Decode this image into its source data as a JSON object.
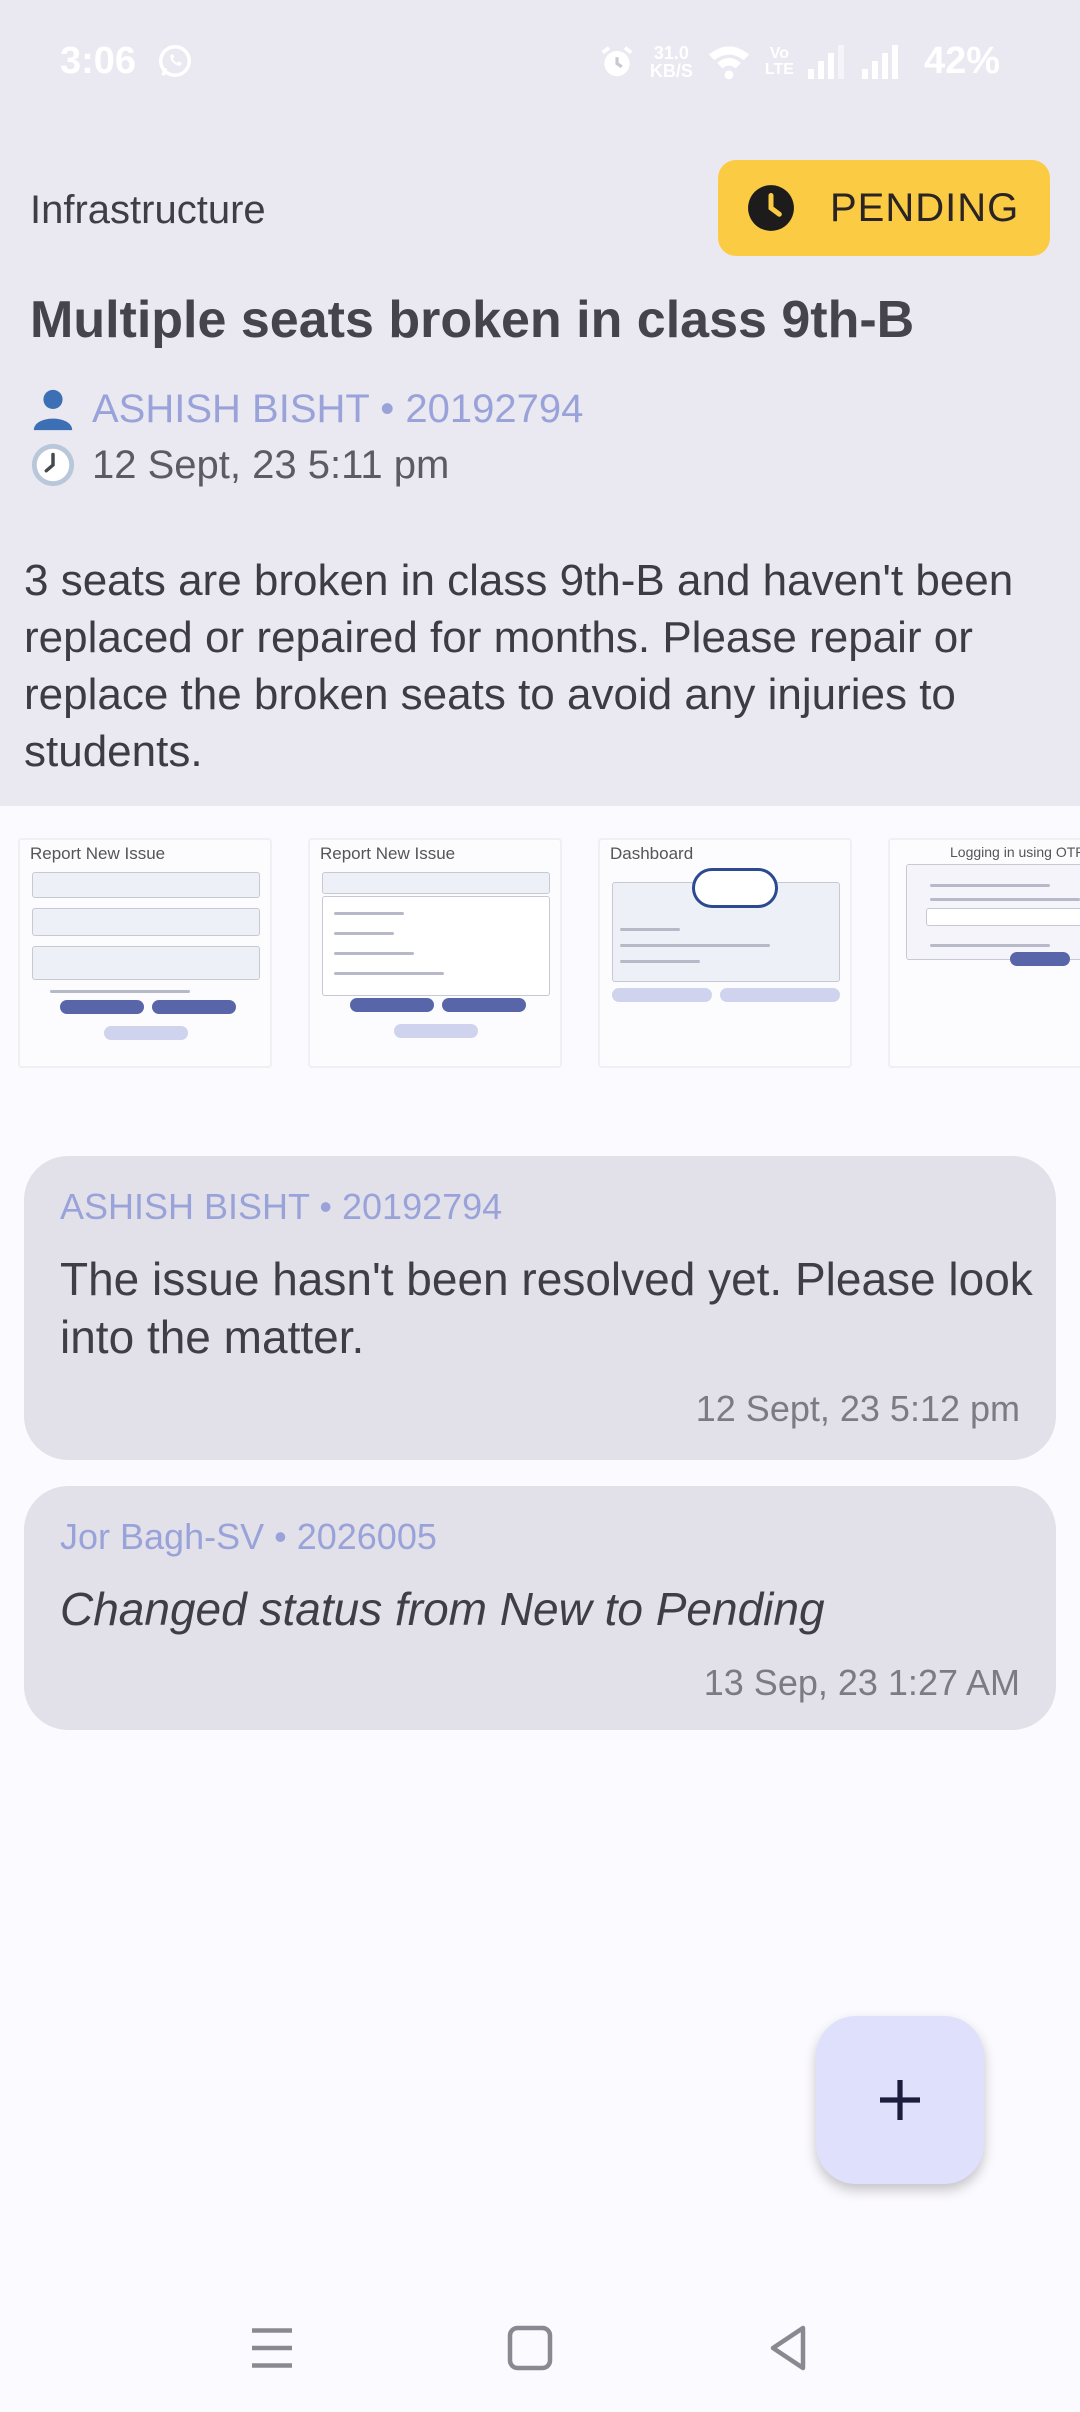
{
  "status_bar": {
    "time": "3:06",
    "speed_value": "31.0",
    "speed_unit": "KB/S",
    "volte_top": "Vo",
    "volte_bottom": "LTE",
    "battery": "42%"
  },
  "issue": {
    "category": "Infrastructure",
    "status_label": "PENDING",
    "title": "Multiple seats broken in class 9th-B",
    "reporter": "ASHISH  BISHT • 20192794",
    "created": "12 Sept, 23  5:11 pm",
    "description": "3 seats are broken in class 9th-B and haven't been replaced or repaired for months. Please repair or replace the broken seats to avoid any injuries to students."
  },
  "attachments": [
    {
      "title": "Report New Issue"
    },
    {
      "title": "Report New Issue"
    },
    {
      "title": "Dashboard"
    },
    {
      "title": "Logging in using OTP"
    }
  ],
  "comments": [
    {
      "author": "ASHISH  BISHT • 20192794",
      "text": "The issue hasn't been resolved yet. Please look into the matter.",
      "time": "12 Sept, 23  5:12 pm"
    },
    {
      "author": "Jor Bagh-SV • 2026005",
      "text": "Changed status from New to Pending",
      "time": "13 Sep, 23  1:27 AM"
    }
  ],
  "colors": {
    "pending_chip": "#fbcb44",
    "author_text": "#9aa3d9",
    "comment_bg": "#e2e1ea",
    "fab_bg": "#dfe0fb"
  },
  "icons": {
    "status": "clock-icon",
    "reporter": "person-icon",
    "created": "clock-emoji-icon",
    "fab": "plus-icon"
  }
}
